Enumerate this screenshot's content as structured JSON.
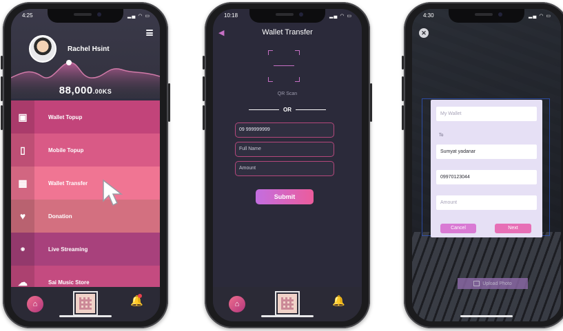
{
  "phone1": {
    "time": "4:25",
    "user_name": "Rachel Hsint",
    "balance_amount": "88,000",
    "balance_unit": ".00KS",
    "menu": [
      {
        "label": "Wallet Topup",
        "icon": "wallet-icon",
        "color": "#c2447a"
      },
      {
        "label": "Mobile Topup",
        "icon": "mobile-phone-icon",
        "color": "#d95a86"
      },
      {
        "label": "Wallet Transfer",
        "icon": "qr-code-icon",
        "color": "#f07593"
      },
      {
        "label": "Donation",
        "icon": "heart-hand-icon",
        "color": "#d37080"
      },
      {
        "label": "Live Streaming",
        "icon": "live-broadcast-icon",
        "color": "#a8417c"
      },
      {
        "label": "Sai Music Store",
        "icon": "music-cloud-icon",
        "color": "#c44b80"
      }
    ]
  },
  "phone2": {
    "time": "10:18",
    "title": "Wallet Transfer",
    "qr_label": "QR Scan",
    "or_label": "OR",
    "phone_value": "09 999999999",
    "fullname_placeholder": "Full Name",
    "amount_placeholder": "Amount",
    "submit_label": "Submit"
  },
  "phone3": {
    "time": "4:30",
    "my_wallet_placeholder": "My Wallet",
    "to_label": "To",
    "recipient_name": "Sumyat yadanar",
    "recipient_phone": "09970123044",
    "amount_placeholder": "Amount",
    "cancel_label": "Cancel",
    "next_label": "Next",
    "upload_label": "Upload Photo"
  }
}
